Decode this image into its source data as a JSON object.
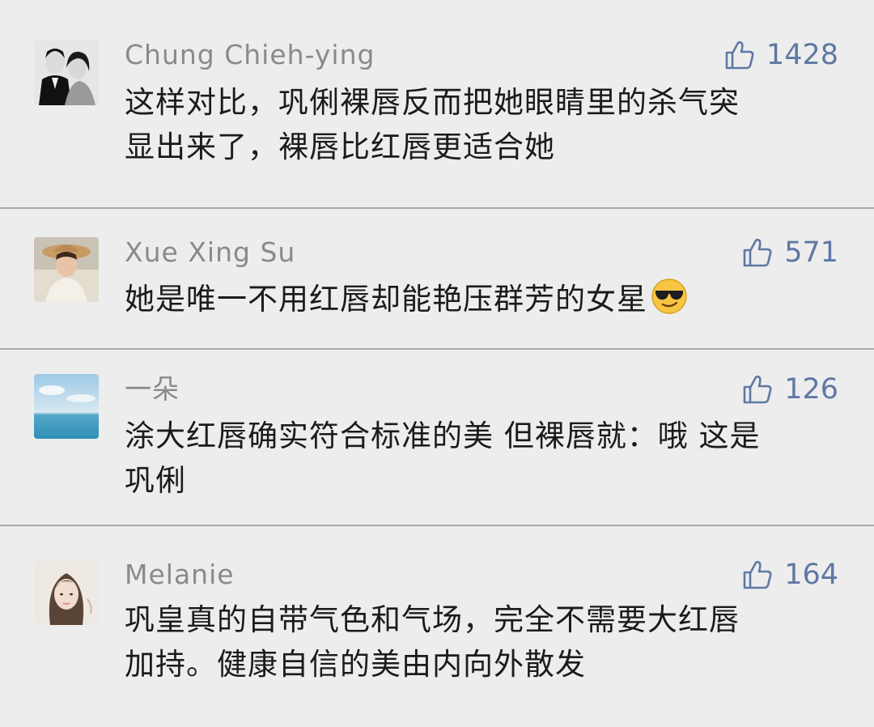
{
  "comments": [
    {
      "author": "Chung Chieh-ying",
      "likes": "1428",
      "avatar_icon": "couple-photo-avatar",
      "lines": [
        "这样对比，巩俐裸唇反而把她眼睛里的杀气突",
        "显出来了，裸唇比红唇更适合她"
      ]
    },
    {
      "author": "Xue Xing Su",
      "likes": "571",
      "avatar_icon": "woman-in-hat-avatar",
      "lines": [
        "她是唯一不用红唇却能艳压群芳的女星"
      ],
      "emoji": "sunglasses-emoji"
    },
    {
      "author": "一朵",
      "likes": "126",
      "avatar_icon": "sea-and-sky-avatar",
      "lines": [
        "涂大红唇确实符合标准的美 但裸唇就：哦 这是",
        "巩俐"
      ]
    },
    {
      "author": "Melanie",
      "likes": "164",
      "avatar_icon": "woman-portrait-avatar",
      "lines": [
        "巩皇真的自带气色和气场，完全不需要大红唇",
        "加持。健康自信的美由内向外散发"
      ]
    }
  ],
  "colors": {
    "background": "#ededed",
    "author": "#8a8a8a",
    "text": "#1b1b1b",
    "like": "#5f78a4",
    "divider": "#a9a9a9"
  }
}
